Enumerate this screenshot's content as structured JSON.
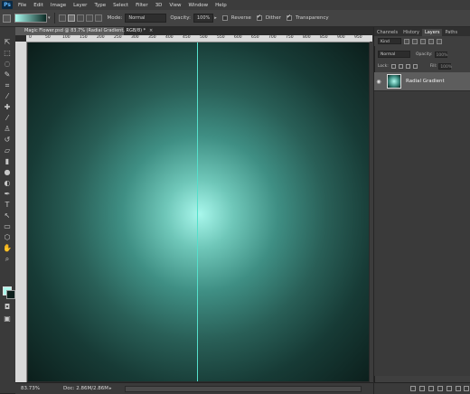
{
  "app": {
    "logo_text": "Ps"
  },
  "menu": [
    "File",
    "Edit",
    "Image",
    "Layer",
    "Type",
    "Select",
    "Filter",
    "3D",
    "View",
    "Window",
    "Help"
  ],
  "options": {
    "mode_label": "Mode:",
    "mode_value": "Normal",
    "opacity_label": "Opacity:",
    "opacity_value": "100%",
    "reverse_label": "Reverse",
    "dither_label": "Dither",
    "transparency_label": "Transparency"
  },
  "document": {
    "tab_title": "Magic Flower.psd @ 83.7% (Radial Gradient, RGB/8) *",
    "close_glyph": "×",
    "ruler_labels": [
      "0",
      "50",
      "100",
      "150",
      "200",
      "250",
      "300",
      "350",
      "400",
      "450",
      "500",
      "550",
      "600",
      "650",
      "700",
      "750",
      "800",
      "850",
      "900",
      "950"
    ],
    "guide_color": "#55e0cc"
  },
  "status": {
    "zoom": "83.73%",
    "doc_size": "Doc: 2.86M/2.86M"
  },
  "panel": {
    "tabs": [
      "Channels",
      "History",
      "Layers",
      "Paths"
    ],
    "active_tab": "Layers",
    "kind_label": "Kind",
    "blend_mode": "Normal",
    "opacity_label": "Opacity:",
    "opacity_value": "100%",
    "lock_label": "Lock:",
    "fill_label": "Fill:",
    "fill_value": "100%",
    "layer_name": "Radial Gradient"
  },
  "colors": {
    "foreground": "#aef7ec",
    "background": "#0d1e1b",
    "gradient_center": "#a8f7ec",
    "gradient_edge": "#0b1d1a"
  }
}
